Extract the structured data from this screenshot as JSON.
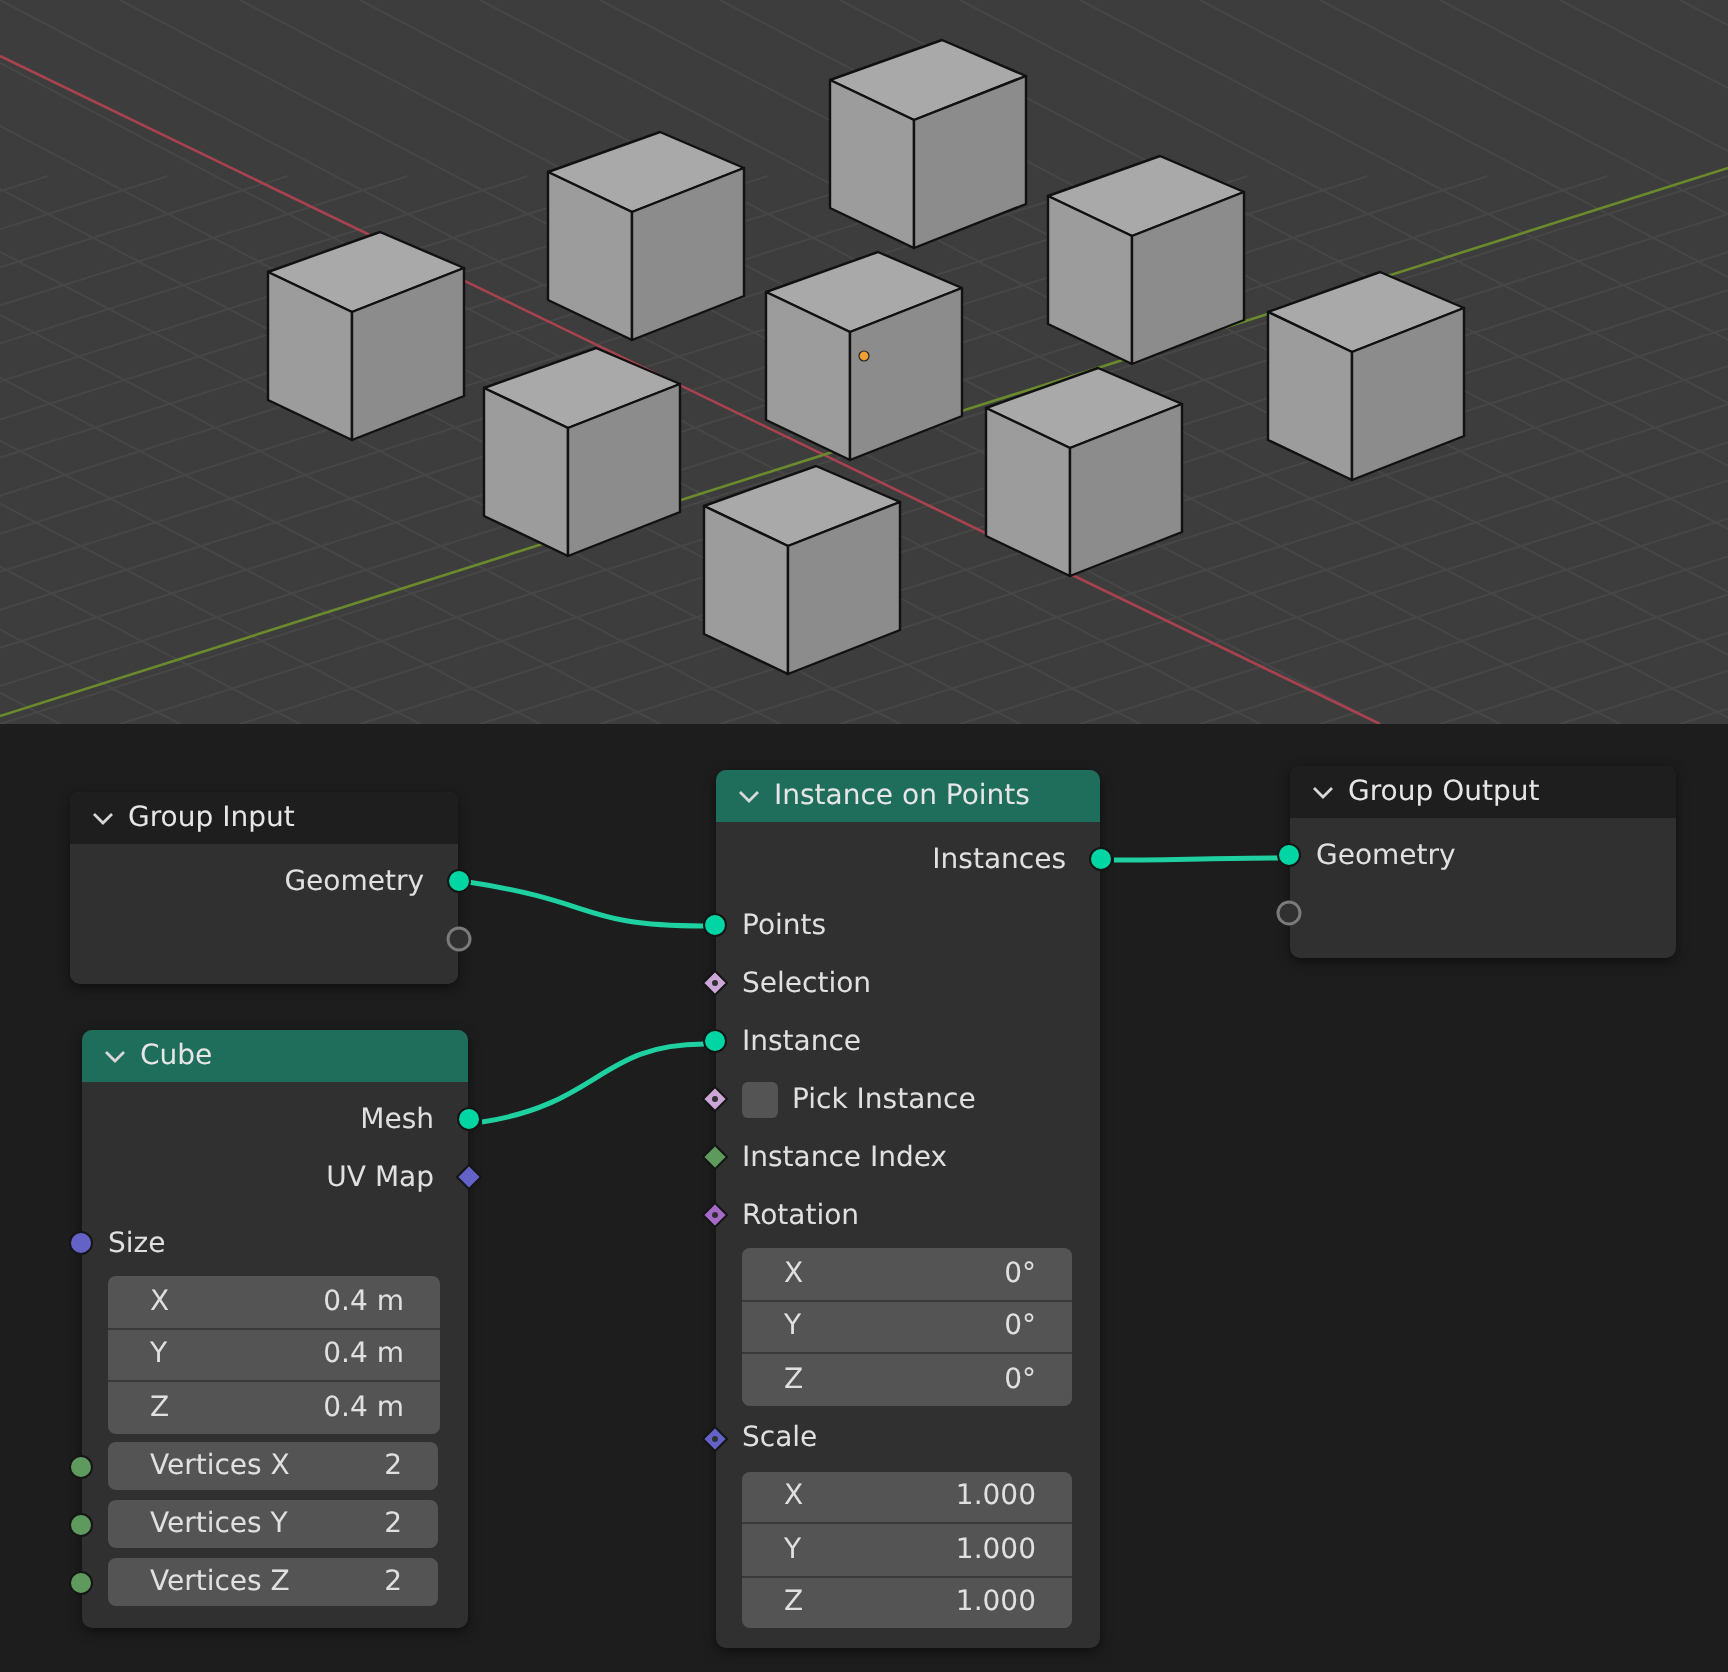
{
  "nodes": [
    {
      "title": "Group Input",
      "color": "#1e1e1e",
      "rows": [
        {
          "kind": "output",
          "label": "Geometry",
          "socket": {
            "kind": "circle",
            "color": "#00d6a3"
          }
        },
        {
          "kind": "virtual_output",
          "socket": {
            "kind": "hollow",
            "color": "#7a7a7a"
          }
        }
      ]
    },
    {
      "title": "Cube",
      "color": "#1f6e5c",
      "rows": [
        {
          "kind": "output",
          "label": "Mesh",
          "socket": {
            "kind": "circle",
            "color": "#00d6a3"
          }
        },
        {
          "kind": "output",
          "label": "UV Map",
          "socket": {
            "kind": "diamond",
            "color": "#6363c7"
          }
        },
        {
          "kind": "input",
          "label": "Size",
          "socket": {
            "kind": "circle",
            "color": "#6363c7"
          }
        },
        {
          "kind": "vector",
          "fields": [
            {
              "axis": "X",
              "value": "0.4 m"
            },
            {
              "axis": "Y",
              "value": "0.4 m"
            },
            {
              "axis": "Z",
              "value": "0.4 m"
            }
          ]
        },
        {
          "kind": "number_input",
          "label": "Vertices X",
          "value": "2",
          "socket": {
            "kind": "circle",
            "color": "#5e9a5e"
          }
        },
        {
          "kind": "number_input",
          "label": "Vertices Y",
          "value": "2",
          "socket": {
            "kind": "circle",
            "color": "#5e9a5e"
          }
        },
        {
          "kind": "number_input",
          "label": "Vertices Z",
          "value": "2",
          "socket": {
            "kind": "circle",
            "color": "#5e9a5e"
          }
        }
      ]
    },
    {
      "title": "Instance on Points",
      "color": "#1f6e5c",
      "rows": [
        {
          "kind": "output",
          "label": "Instances",
          "socket": {
            "kind": "circle",
            "color": "#00d6a3"
          }
        },
        {
          "kind": "input",
          "label": "Points",
          "socket": {
            "kind": "circle",
            "color": "#00d6a3"
          }
        },
        {
          "kind": "input",
          "label": "Selection",
          "socket": {
            "kind": "diamond_dot",
            "color": "#cca6d6"
          }
        },
        {
          "kind": "input",
          "label": "Instance",
          "socket": {
            "kind": "circle",
            "color": "#00d6a3"
          }
        },
        {
          "kind": "checkbox_input",
          "label": "Pick Instance",
          "checked": false,
          "socket": {
            "kind": "diamond_dot",
            "color": "#cca6d6"
          }
        },
        {
          "kind": "input",
          "label": "Instance Index",
          "socket": {
            "kind": "diamond",
            "color": "#5e9a5e"
          }
        },
        {
          "kind": "input",
          "label": "Rotation",
          "socket": {
            "kind": "diamond_dot",
            "color": "#a56ac8"
          }
        },
        {
          "kind": "vector",
          "fields": [
            {
              "axis": "X",
              "value": "0°"
            },
            {
              "axis": "Y",
              "value": "0°"
            },
            {
              "axis": "Z",
              "value": "0°"
            }
          ]
        },
        {
          "kind": "input",
          "label": "Scale",
          "socket": {
            "kind": "diamond_dot",
            "color": "#6363c7"
          }
        },
        {
          "kind": "vector",
          "fields": [
            {
              "axis": "X",
              "value": "1.000"
            },
            {
              "axis": "Y",
              "value": "1.000"
            },
            {
              "axis": "Z",
              "value": "1.000"
            }
          ]
        }
      ]
    },
    {
      "title": "Group Output",
      "color": "#1e1e1e",
      "rows": [
        {
          "kind": "input",
          "label": "Geometry",
          "socket": {
            "kind": "circle",
            "color": "#00d6a3"
          }
        },
        {
          "kind": "virtual_input",
          "socket": {
            "kind": "hollow",
            "color": "#7a7a7a"
          }
        }
      ]
    }
  ]
}
